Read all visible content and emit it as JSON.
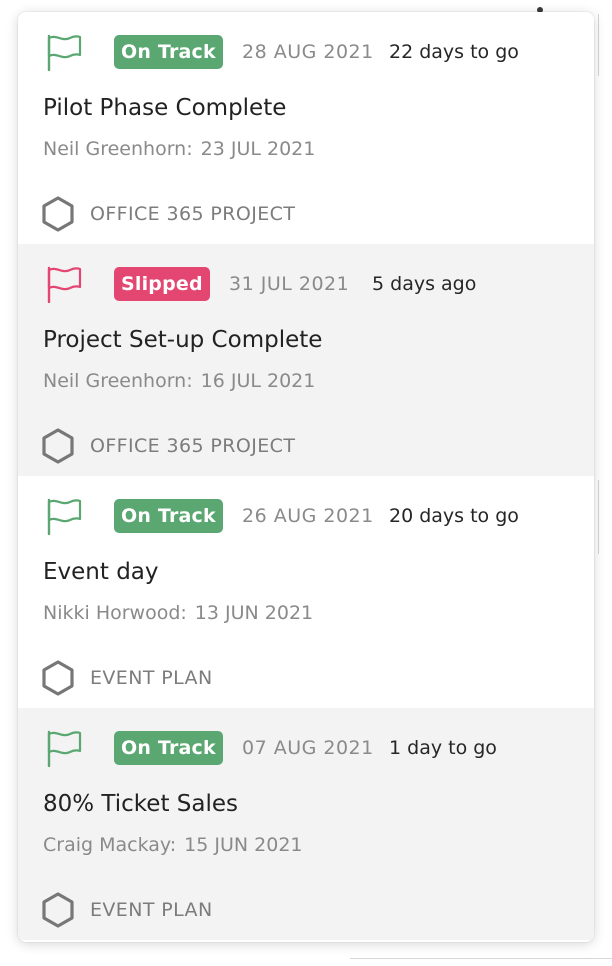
{
  "colors": {
    "on_track": "#5aa772",
    "slipped": "#e44672",
    "card_alt_bg": "#f3f3f3",
    "muted_text": "#8a8a8a"
  },
  "milestones": [
    {
      "status": "On Track",
      "status_key": "on-track",
      "flag_icon": "flag-outline-icon",
      "date": "28 AUG 2021",
      "relative": "22 days to go",
      "title": "Pilot Phase Complete",
      "owner": "Neil Greenhorn:",
      "owner_date": "23 JUL 2021",
      "project_icon": "hexagon-icon",
      "project": "OFFICE 365 PROJECT"
    },
    {
      "status": "Slipped",
      "status_key": "slipped",
      "flag_icon": "flag-outline-icon",
      "date": "31 JUL 2021",
      "relative": "5 days ago",
      "title": "Project Set-up Complete",
      "owner": "Neil Greenhorn:",
      "owner_date": "16 JUL 2021",
      "project_icon": "hexagon-icon",
      "project": "OFFICE 365 PROJECT"
    },
    {
      "status": "On Track",
      "status_key": "on-track",
      "flag_icon": "flag-outline-icon",
      "date": "26 AUG 2021",
      "relative": "20 days to go",
      "title": "Event day",
      "owner": "Nikki Horwood:",
      "owner_date": "13 JUN 2021",
      "project_icon": "hexagon-icon",
      "project": "EVENT PLAN"
    },
    {
      "status": "On Track",
      "status_key": "on-track",
      "flag_icon": "flag-outline-icon",
      "date": "07 AUG 2021",
      "relative": "1 day to go",
      "title": "80% Ticket Sales",
      "owner": "Craig Mackay:",
      "owner_date": "15 JUN 2021",
      "project_icon": "hexagon-icon",
      "project": "EVENT PLAN"
    }
  ]
}
